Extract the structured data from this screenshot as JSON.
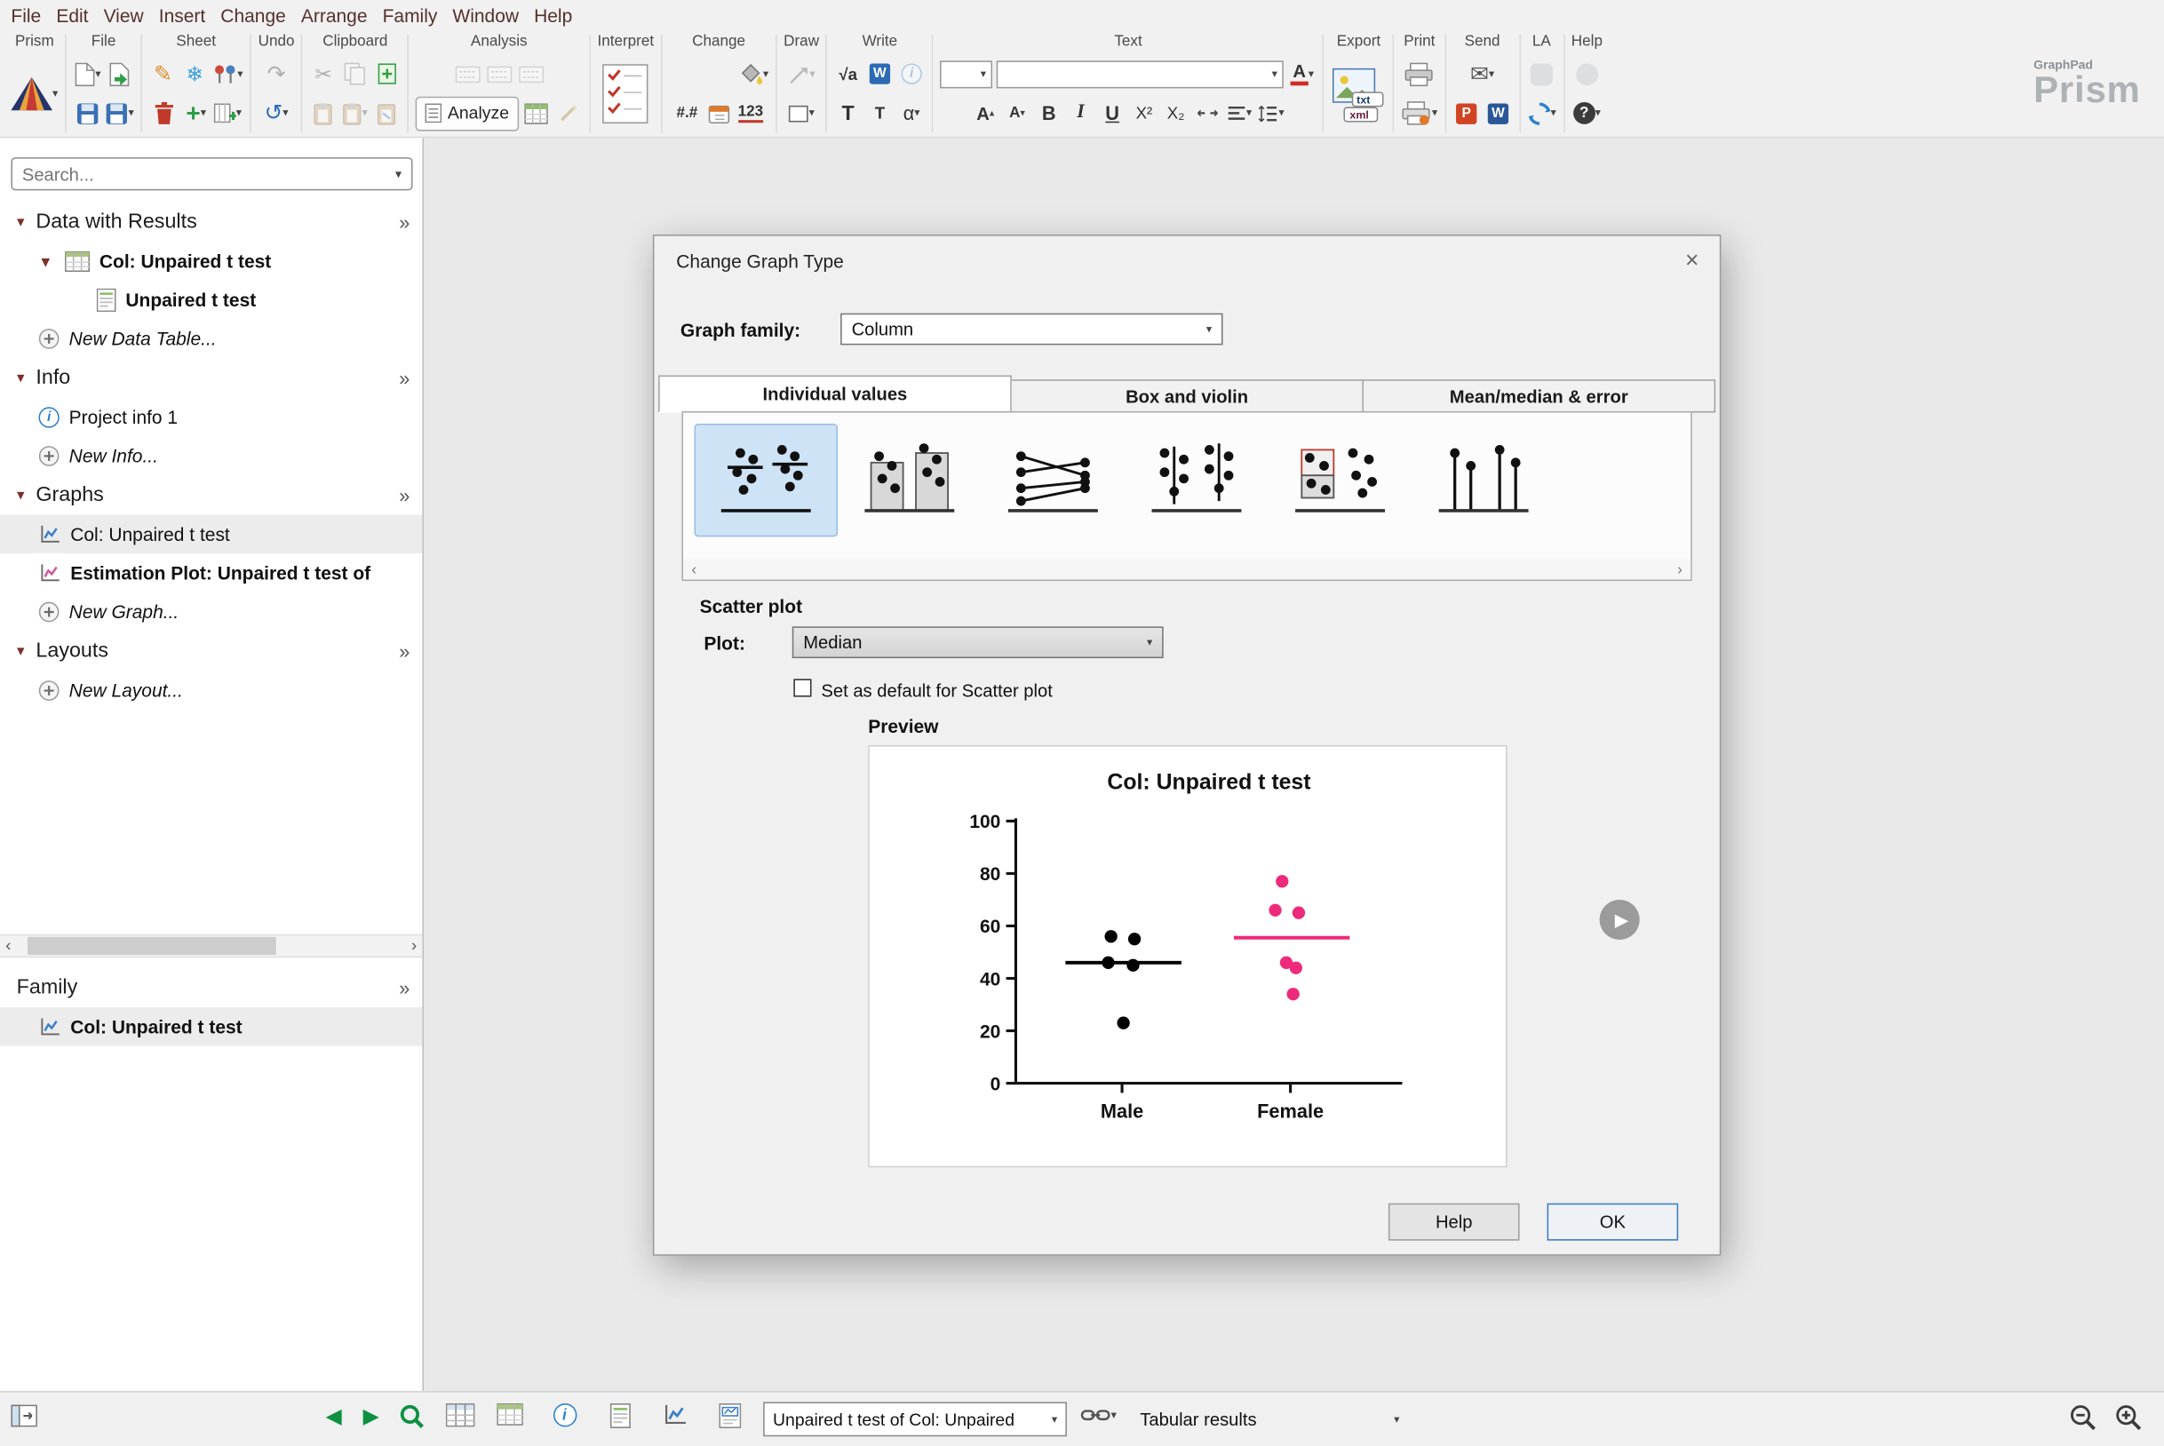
{
  "menu": {
    "items": [
      "File",
      "Edit",
      "View",
      "Insert",
      "Change",
      "Arrange",
      "Family",
      "Window",
      "Help"
    ]
  },
  "icons": {
    "caret": "▾",
    "caret_up": "▴",
    "left": "‹",
    "right": "›",
    "guillemet": "»",
    "close": "×",
    "snowflake": "❄",
    "scissors": "✂",
    "undo": "↺",
    "redo": "↷",
    "envelope": "✉",
    "back": "◀",
    "forward": "▶",
    "play": "▶",
    "pencil": "✎",
    "question": "?",
    "info": "i",
    "tree_expanded": "▾",
    "plus": "+"
  },
  "toolbar": {
    "groups": {
      "prism": "Prism",
      "file": "File",
      "sheet": "Sheet",
      "undo": "Undo",
      "clipboard": "Clipboard",
      "analysis": "Analysis",
      "interpret": "Interpret",
      "change": "Change",
      "draw": "Draw",
      "write": "Write",
      "text": "Text",
      "export": "Export",
      "print": "Print",
      "send": "Send",
      "la": "LA",
      "help": "Help"
    },
    "glyphs": {
      "analyze": "Analyze",
      "numfmt": "#.#",
      "decimals": "123",
      "sqrt": "√a",
      "lookup": "W",
      "text_large": "T",
      "text_small": "T",
      "alpha": "α",
      "grow": "A",
      "shrink": "A",
      "bold": "B",
      "italic": "I",
      "underline": "U",
      "superscript": "X²",
      "subscript": "X₂",
      "color": "A",
      "ppt": "P",
      "word": "W",
      "txt": "txt",
      "xml": "xml"
    },
    "brand": {
      "top": "GraphPad",
      "name": "Prism"
    }
  },
  "sidebar": {
    "search_placeholder": "Search...",
    "sections": {
      "data": {
        "label": "Data with Results",
        "table_item": "Col: Unpaired t test",
        "results_item": "Unpaired t test",
        "new_item": "New Data Table..."
      },
      "info": {
        "label": "Info",
        "project_item": "Project info 1",
        "new_item": "New Info..."
      },
      "graphs": {
        "label": "Graphs",
        "graph_item": "Col: Unpaired t test",
        "estimation_item": "Estimation Plot: Unpaired t test of",
        "new_item": "New Graph..."
      },
      "layouts": {
        "label": "Layouts",
        "new_item": "New Layout..."
      }
    },
    "family": {
      "label": "Family",
      "item": "Col: Unpaired t test"
    }
  },
  "dialog": {
    "title": "Change Graph Type",
    "graph_family_label": "Graph family:",
    "graph_family_value": "Column",
    "tabs": [
      "Individual values",
      "Box and violin",
      "Mean/median & error"
    ],
    "thumbnails": [
      "scatter-with-median",
      "scatter-on-bar",
      "before-after-lines",
      "aligned-dot-plot",
      "scatter-with-boxes",
      "spike-plot"
    ],
    "scatter_section_label": "Scatter plot",
    "plot_label": "Plot:",
    "plot_value": "Median",
    "default_checkbox_label": "Set as default for Scatter plot",
    "checkbox_checked": false,
    "preview_label": "Preview",
    "help_button": "Help",
    "ok_button": "OK",
    "chart_data": {
      "type": "scatter",
      "title": "Col: Unpaired t test",
      "ylim": [
        0,
        100
      ],
      "yticks": [
        0,
        20,
        40,
        60,
        80,
        100
      ],
      "categories": [
        "Male",
        "Female"
      ],
      "series": [
        {
          "name": "Male",
          "color": "#000000",
          "values": [
            56,
            55,
            46,
            45,
            23
          ],
          "dx": [
            -8,
            9,
            -10,
            8,
            1
          ],
          "median": 46
        },
        {
          "name": "Female",
          "color": "#ee2a7b",
          "values": [
            77,
            66,
            65,
            46,
            44,
            34
          ],
          "dx": [
            -6,
            -11,
            6,
            -3,
            4,
            2
          ],
          "median": 55.5
        }
      ],
      "legend": "none",
      "grid": false
    }
  },
  "statusbar": {
    "sheet_selector": "Unpaired t test of Col: Unpaired",
    "view_selector": "Tabular results"
  }
}
